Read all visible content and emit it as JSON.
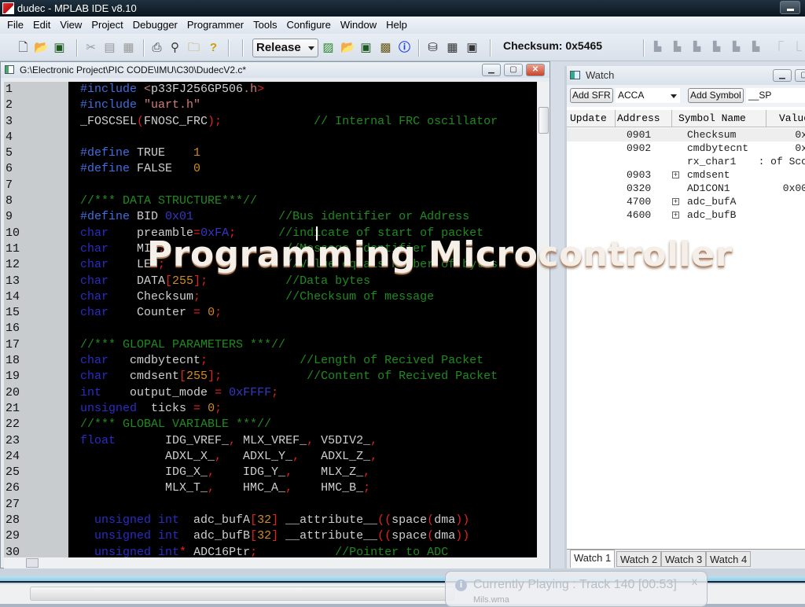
{
  "window": {
    "title": "dudec - MPLAB IDE v8.10"
  },
  "menu": [
    "File",
    "Edit",
    "View",
    "Project",
    "Debugger",
    "Programmer",
    "Tools",
    "Configure",
    "Window",
    "Help"
  ],
  "toolbar": {
    "build_config": "Release",
    "checksum_label": "Checksum: 0x5465",
    "icons": [
      "new-file-icon",
      "open-file-icon",
      "save-icon",
      "cut-icon",
      "copy-icon",
      "paste-icon",
      "print-icon",
      "find-icon",
      "find-in-files-icon",
      "help-icon",
      "new-project-icon",
      "open-project-icon",
      "save-project-icon",
      "build-icon",
      "info-icon",
      "program-device-icon",
      "memory-icon",
      "export-icon"
    ],
    "debug_icons": [
      "step-into-icon",
      "step-over-icon",
      "step-out-icon",
      "reset-icon",
      "run-icon",
      "halt-icon",
      "breakpoint-up-icon",
      "breakpoint-down-icon"
    ]
  },
  "editor": {
    "title": "G:\\Electronic Project\\PIC CODE\\IMU\\C30\\DudecV2.c*",
    "line_numbers": [
      "1",
      "2",
      "3",
      "4",
      "5",
      "6",
      "7",
      "8",
      "9",
      "10",
      "11",
      "12",
      "13",
      "14",
      "15",
      "16",
      "17",
      "18",
      "19",
      "20",
      "21",
      "22",
      "23",
      "24",
      "25",
      "26",
      "27",
      "28",
      "29",
      "30"
    ],
    "lines": [
      [
        [
          "pp",
          "#include "
        ],
        [
          "str",
          "<"
        ],
        [
          "id",
          "p33FJ256GP506"
        ],
        [
          "str",
          ".h"
        ],
        [
          "op",
          ">"
        ]
      ],
      [
        [
          "pp",
          "#include "
        ],
        [
          "str",
          "\"uart.h\""
        ]
      ],
      [
        [
          "id",
          "_FOSCSEL"
        ],
        [
          "op",
          "("
        ],
        [
          "id",
          "FNOSC_FRC"
        ],
        [
          "op",
          ");"
        ],
        [
          "id",
          "             "
        ],
        [
          "cm",
          "// Internal FRC oscillator"
        ]
      ],
      [],
      [
        [
          "pp",
          "#define "
        ],
        [
          "id",
          "TRUE    "
        ],
        [
          "num",
          "1"
        ]
      ],
      [
        [
          "pp",
          "#define "
        ],
        [
          "id",
          "FALSE   "
        ],
        [
          "num",
          "0"
        ]
      ],
      [],
      [
        [
          "cm",
          "//*** DATA STRUCTURE***//"
        ]
      ],
      [
        [
          "pp",
          "#define "
        ],
        [
          "id",
          "BID "
        ],
        [
          "hex",
          "0x01"
        ],
        [
          "id",
          "            "
        ],
        [
          "cm",
          "//Bus identifier or Address"
        ]
      ],
      [
        [
          "kw2",
          "char"
        ],
        [
          "id",
          "    preamble"
        ],
        [
          "op",
          "="
        ],
        [
          "hex",
          "0xFA"
        ],
        [
          "op",
          ";"
        ],
        [
          "id",
          "      "
        ],
        [
          "cm",
          "//indicate of start of packet"
        ]
      ],
      [
        [
          "kw2",
          "char"
        ],
        [
          "id",
          "    MID"
        ],
        [
          "op",
          ";"
        ],
        [
          "id",
          "                 "
        ],
        [
          "cm",
          "//Message identifier"
        ]
      ],
      [
        [
          "kw2",
          "char"
        ],
        [
          "id",
          "    LEN"
        ],
        [
          "op",
          ";"
        ],
        [
          "id",
          "                 "
        ],
        [
          "cm",
          "//Value equals number of bytes"
        ]
      ],
      [
        [
          "kw2",
          "char"
        ],
        [
          "id",
          "    DATA"
        ],
        [
          "op",
          "["
        ],
        [
          "num",
          "255"
        ],
        [
          "op",
          "];"
        ],
        [
          "id",
          "           "
        ],
        [
          "cm",
          "//Data bytes"
        ]
      ],
      [
        [
          "kw2",
          "char"
        ],
        [
          "id",
          "    Checksum"
        ],
        [
          "op",
          ";"
        ],
        [
          "id",
          "            "
        ],
        [
          "cm",
          "//Checksum of message"
        ]
      ],
      [
        [
          "kw2",
          "char"
        ],
        [
          "id",
          "    Counter "
        ],
        [
          "op",
          "="
        ],
        [
          "id",
          " "
        ],
        [
          "num",
          "0"
        ],
        [
          "op",
          ";"
        ]
      ],
      [],
      [
        [
          "cm",
          "//*** GLOPAL PARAMETERS ***//"
        ]
      ],
      [
        [
          "kw2",
          "char"
        ],
        [
          "id",
          "   cmdbytecnt"
        ],
        [
          "op",
          ";"
        ],
        [
          "id",
          "             "
        ],
        [
          "cm",
          "//Length of Recived Packet"
        ]
      ],
      [
        [
          "kw2",
          "char"
        ],
        [
          "id",
          "   cmdsent"
        ],
        [
          "op",
          "["
        ],
        [
          "num",
          "255"
        ],
        [
          "op",
          "];"
        ],
        [
          "id",
          "            "
        ],
        [
          "cm",
          "//Content of Recived Packet"
        ]
      ],
      [
        [
          "kw2",
          "int"
        ],
        [
          "id",
          "    output_mode "
        ],
        [
          "op",
          "="
        ],
        [
          "id",
          " "
        ],
        [
          "hex",
          "0xFFFF"
        ],
        [
          "op",
          ";"
        ]
      ],
      [
        [
          "kw2",
          "unsigned"
        ],
        [
          "id",
          "  ticks "
        ],
        [
          "op",
          "="
        ],
        [
          "id",
          " "
        ],
        [
          "num",
          "0"
        ],
        [
          "op",
          ";"
        ]
      ],
      [
        [
          "cm",
          "//*** GLOBAL VARIABLE ***//"
        ]
      ],
      [
        [
          "kw2",
          "float"
        ],
        [
          "id",
          "       IDG_VREF_"
        ],
        [
          "op",
          ","
        ],
        [
          "id",
          " MLX_VREF_"
        ],
        [
          "op",
          ","
        ],
        [
          "id",
          " V5DIV2_"
        ],
        [
          "op",
          ","
        ]
      ],
      [
        [
          "id",
          "            ADXL_X_"
        ],
        [
          "op",
          ","
        ],
        [
          "id",
          "   ADXL_Y_"
        ],
        [
          "op",
          ","
        ],
        [
          "id",
          "   ADXL_Z_"
        ],
        [
          "op",
          ","
        ]
      ],
      [
        [
          "id",
          "            IDG_X_"
        ],
        [
          "op",
          ","
        ],
        [
          "id",
          "    IDG_Y_"
        ],
        [
          "op",
          ","
        ],
        [
          "id",
          "    MLX_Z_"
        ],
        [
          "op",
          ","
        ]
      ],
      [
        [
          "id",
          "            MLX_T_"
        ],
        [
          "op",
          ","
        ],
        [
          "id",
          "    HMC_A_"
        ],
        [
          "op",
          ","
        ],
        [
          "id",
          "    HMC_B_"
        ],
        [
          "op",
          ";"
        ]
      ],
      [],
      [
        [
          "id",
          "  "
        ],
        [
          "kw2",
          "unsigned int"
        ],
        [
          "id",
          "  adc_bufA"
        ],
        [
          "op",
          "["
        ],
        [
          "num",
          "32"
        ],
        [
          "op",
          "]"
        ],
        [
          "id",
          " __attribute__"
        ],
        [
          "op",
          "(("
        ],
        [
          "id",
          "space"
        ],
        [
          "op",
          "("
        ],
        [
          "id",
          "dma"
        ],
        [
          "op",
          "))"
        ]
      ],
      [
        [
          "id",
          "  "
        ],
        [
          "kw2",
          "unsigned int"
        ],
        [
          "id",
          "  adc_bufB"
        ],
        [
          "op",
          "["
        ],
        [
          "num",
          "32"
        ],
        [
          "op",
          "]"
        ],
        [
          "id",
          " __attribute__"
        ],
        [
          "op",
          "(("
        ],
        [
          "id",
          "space"
        ],
        [
          "op",
          "("
        ],
        [
          "id",
          "dma"
        ],
        [
          "op",
          "))"
        ]
      ],
      [
        [
          "id",
          "  "
        ],
        [
          "kw2",
          "unsigned int"
        ],
        [
          "op",
          "*"
        ],
        [
          "id",
          " ADC16Ptr"
        ],
        [
          "op",
          ";"
        ],
        [
          "id",
          "           "
        ],
        [
          "cm",
          "//Pointer to ADC"
        ]
      ]
    ]
  },
  "watch": {
    "title": "Watch",
    "add_sfr_label": "Add SFR",
    "sfr_value": "ACCA",
    "add_symbol_label": "Add Symbol",
    "symbol_value": "__SP",
    "columns": [
      "Update",
      "Address",
      "Symbol Name",
      "Value"
    ],
    "rows": [
      {
        "address": "0901",
        "symbol": "Checksum",
        "value": "0x",
        "expandable": false
      },
      {
        "address": "0902",
        "symbol": "cmdbytecnt",
        "value": "0x",
        "expandable": false
      },
      {
        "address": "",
        "symbol": "rx_char1",
        "value": ": of Sco",
        "expandable": false
      },
      {
        "address": "0903",
        "symbol": "cmdsent",
        "value": "",
        "expandable": true
      },
      {
        "address": "0320",
        "symbol": "AD1CON1",
        "value": "0x00",
        "expandable": false
      },
      {
        "address": "4700",
        "symbol": "adc_bufA",
        "value": "",
        "expandable": true
      },
      {
        "address": "4600",
        "symbol": "adc_bufB",
        "value": "",
        "expandable": true
      }
    ],
    "tabs": [
      "Watch 1",
      "Watch 2",
      "Watch 3",
      "Watch 4"
    ],
    "active_tab": "Watch 1"
  },
  "overlay": {
    "caption": "Programming Microcontroller"
  },
  "notification": {
    "message": "Currently Playing : Track 140 [00:53]",
    "sub": "Mils.wma",
    "close": "x"
  }
}
